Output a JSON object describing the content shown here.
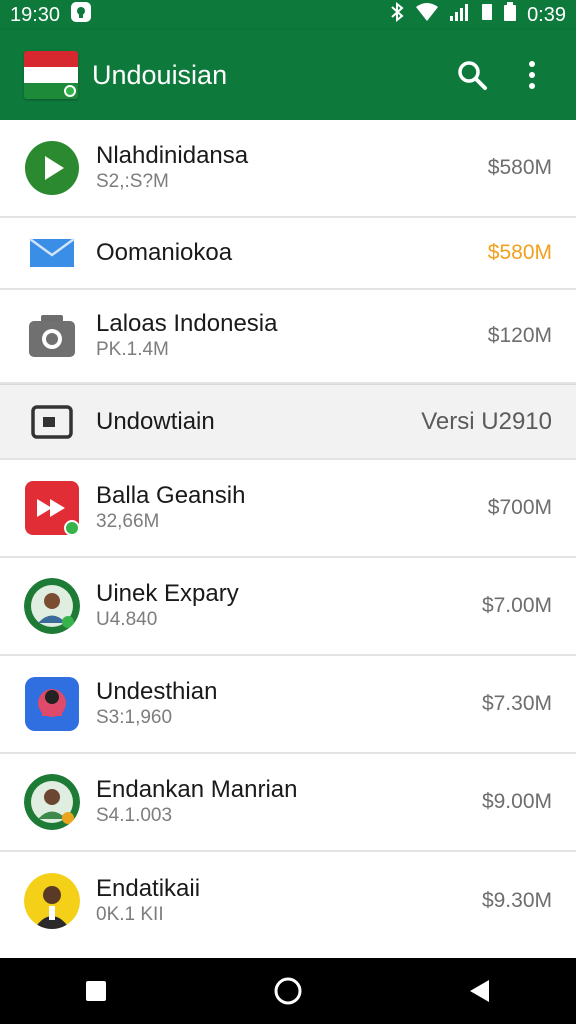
{
  "status_bar": {
    "time": "19:30",
    "right_time": "0:39"
  },
  "app_bar": {
    "title": "Undouisian"
  },
  "colors": {
    "brand_green": "#0d7a3c",
    "accent_orange": "#f2a01d",
    "flag_red": "#d7282f"
  },
  "rows": [
    {
      "name": "Nlahdinidansa",
      "sub": "S2,:S?M",
      "price": "$580M",
      "icon": "play-icon"
    },
    {
      "name": "Oomaniokoa",
      "sub": "",
      "price": "$580M",
      "icon": "mail-icon"
    },
    {
      "name": "Laloas Indonesia",
      "sub": "PK.1.4M",
      "price": "$120M",
      "icon": "camera-icon"
    },
    {
      "name": "Undowtiain",
      "sub": "",
      "price": "Versi U2910",
      "icon": "screen-icon"
    },
    {
      "name": "Balla Geansih",
      "sub": "32,66M",
      "price": "$700M",
      "icon": "fast-forward-app-icon"
    },
    {
      "name": "Uinek Expary",
      "sub": "U4.840",
      "price": "$7.00M",
      "icon": "person-avatar"
    },
    {
      "name": "Undesthian",
      "sub": "S3:1,960",
      "price": "$7.30M",
      "icon": "person-app-icon"
    },
    {
      "name": "Endankan Manrian",
      "sub": "S4.1.003",
      "price": "$9.00M",
      "icon": "person-avatar"
    },
    {
      "name": "Endatikaii",
      "sub": "0K.1 KII",
      "price": "$9.30M",
      "icon": "person-avatar"
    }
  ]
}
